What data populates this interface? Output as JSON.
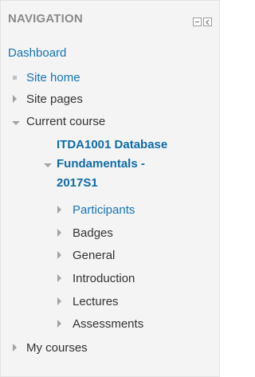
{
  "block": {
    "title": "NAVIGATION",
    "controls": {
      "collapse": "minimize-icon",
      "dock": "dock-icon"
    }
  },
  "nav": {
    "dashboard": "Dashboard",
    "site_home": "Site home",
    "site_pages": "Site pages",
    "current_course": "Current course",
    "course_name_line1": "ITDA1001 Database",
    "course_name_line2": "Fundamentals -",
    "course_name_line3": "2017S1",
    "course_items": [
      "Participants",
      "Badges",
      "General",
      "Introduction",
      "Lectures",
      "Assessments"
    ],
    "my_courses": "My courses"
  },
  "colors": {
    "link": "#1474b3",
    "text": "#333333",
    "title": "#8a8a8a",
    "background": "#f4f4f4"
  }
}
